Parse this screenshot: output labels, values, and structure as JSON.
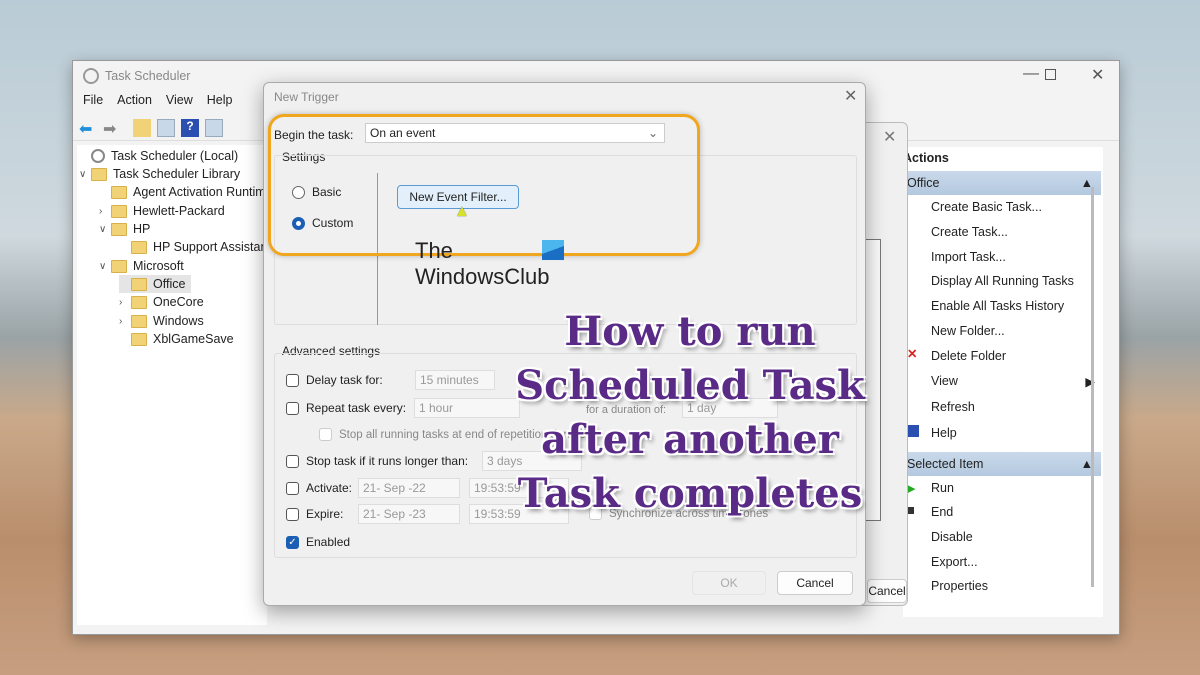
{
  "main_window": {
    "title": "Task Scheduler",
    "menu": [
      "File",
      "Action",
      "View",
      "Help"
    ],
    "tree": [
      {
        "label": "Task Scheduler (Local)",
        "level": 0,
        "chevron": ""
      },
      {
        "label": "Task Scheduler Library",
        "level": 0,
        "chevron": "expanded"
      },
      {
        "label": "Agent Activation Runtime",
        "level": 1,
        "chevron": ""
      },
      {
        "label": "Hewlett-Packard",
        "level": 1,
        "chevron": "collapsed"
      },
      {
        "label": "HP",
        "level": 1,
        "chevron": "expanded"
      },
      {
        "label": "HP Support Assistant",
        "level": 2,
        "chevron": ""
      },
      {
        "label": "Microsoft",
        "level": 1,
        "chevron": "expanded"
      },
      {
        "label": "Office",
        "level": 2,
        "chevron": "",
        "selected": true
      },
      {
        "label": "OneCore",
        "level": 2,
        "chevron": "collapsed"
      },
      {
        "label": "Windows",
        "level": 2,
        "chevron": "collapsed"
      },
      {
        "label": "XblGameSave",
        "level": 2,
        "chevron": ""
      }
    ],
    "actions": {
      "title": "Actions",
      "section1": "Office",
      "items1": [
        "Create Basic Task...",
        "Create Task...",
        "Import Task...",
        "Display All Running Tasks",
        "Enable All Tasks History",
        "New Folder...",
        "Delete Folder",
        "View",
        "Refresh",
        "Help"
      ],
      "section2": "Selected Item",
      "items2": [
        "Run",
        "End",
        "Disable",
        "Export...",
        "Properties"
      ]
    },
    "behind_cancel": "Cancel"
  },
  "dialog": {
    "title": "New Trigger",
    "begin_label": "Begin the task:",
    "begin_value": "On an event",
    "settings_label": "Settings",
    "radio_basic": "Basic",
    "radio_custom": "Custom",
    "selected_radio": "Custom",
    "event_filter_button": "New Event Filter...",
    "advanced_label": "Advanced settings",
    "delay_label": "Delay task for:",
    "delay_value": "15 minutes",
    "repeat_label": "Repeat task every:",
    "repeat_value": "1 hour",
    "duration_label": "for a duration of:",
    "duration_value": "1 day",
    "stop_all_label": "Stop all running tasks at end of repetition duration",
    "stop_longer_label": "Stop task if it runs longer than:",
    "stop_longer_value": "3 days",
    "activate_label": "Activate:",
    "activate_date": "21- Sep -22",
    "activate_time": "19:53:59",
    "expire_label": "Expire:",
    "expire_date": "21- Sep -23",
    "expire_time": "19:53:59",
    "sync_label": "Synchronize across time zones",
    "enabled_label": "Enabled",
    "enabled_checked": true,
    "ok": "OK",
    "cancel": "Cancel"
  },
  "watermark": {
    "line1": "The",
    "line2": "WindowsClub"
  },
  "overlay_title": [
    "How to run",
    "Scheduled Task",
    "after another",
    "Task completes"
  ],
  "colors": {
    "highlight": "#f0a61e",
    "overlay_text": "#5a2a87",
    "accent": "#1a5fb4"
  }
}
